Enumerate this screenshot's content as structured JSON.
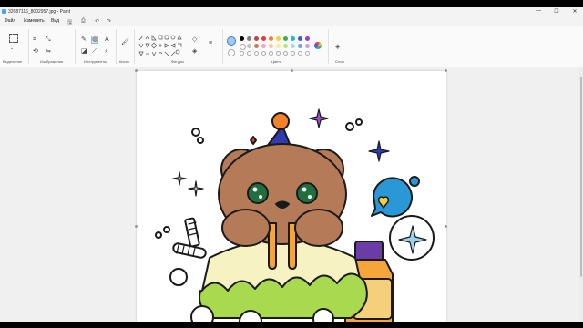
{
  "window": {
    "title": "32687116_8002957.jpg - Paint",
    "controls": {
      "minimize": "—",
      "maximize": "☐",
      "close": "✕"
    }
  },
  "menu": {
    "file": "Файл",
    "edit": "Изменить",
    "view": "Вид"
  },
  "ribbon": {
    "groups": {
      "selection": "Выделение",
      "image": "Изображения",
      "tools": "Инструменты",
      "brushes": "Кисти",
      "shapes": "Фигуры",
      "colors": "Цвета",
      "layers": "Слои"
    },
    "palette_row1": [
      "#000000",
      "#7f7f7f",
      "#b5484a",
      "#e83a3a",
      "#f5822a",
      "#f5d13a",
      "#35b34a",
      "#1fb8c7",
      "#3a5bd6",
      "#9b3ad6"
    ],
    "palette_row2": [
      "#ffffff",
      "#c3c3c3",
      "#c47c5a",
      "#f5a3c3",
      "#f5c98a",
      "#f5eb9a",
      "#b5e67a",
      "#99e0e8",
      "#7a9ae6",
      "#c8a3e6"
    ]
  }
}
